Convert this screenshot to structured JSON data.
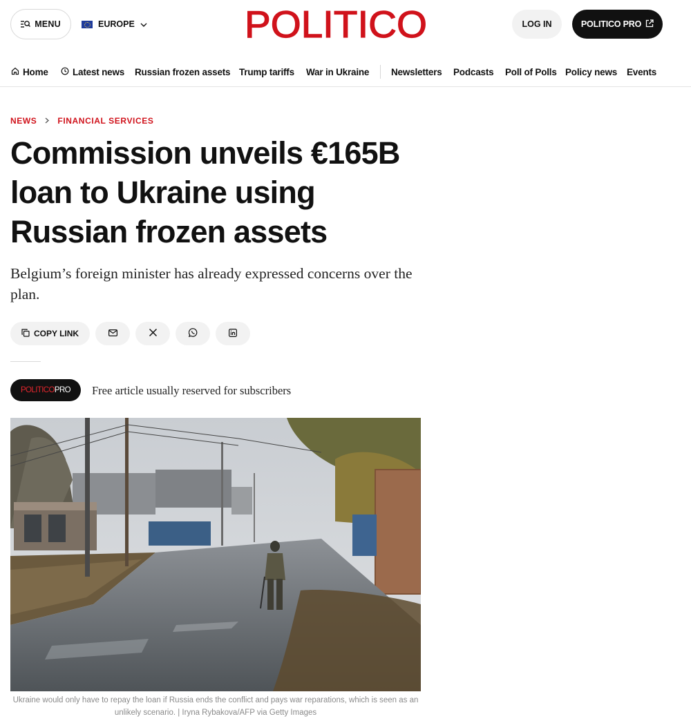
{
  "header": {
    "menu_label": "MENU",
    "edition_label": "EUROPE",
    "logo_text": "POLITICO",
    "login_label": "LOG IN",
    "pro_label": "POLITICO PRO"
  },
  "nav": {
    "items": [
      {
        "label": "Home",
        "icon": "home-icon"
      },
      {
        "label": "Latest news",
        "icon": "clock-icon"
      },
      {
        "label": "Russian frozen assets"
      },
      {
        "label": "Trump tariffs"
      },
      {
        "label": "War in Ukraine"
      },
      {
        "label": "Newsletters"
      },
      {
        "label": "Podcasts"
      },
      {
        "label": "Poll of Polls"
      },
      {
        "label": "Policy news"
      },
      {
        "label": "Events"
      }
    ]
  },
  "article": {
    "breadcrumb": [
      "NEWS",
      "FINANCIAL SERVICES"
    ],
    "headline": "Commission unveils €165B loan to Ukraine using Russian frozen assets",
    "dek": "Belgium’s foreign minister has already expressed concerns over the plan.",
    "share": {
      "copy_link_label": "COPY LINK",
      "icons": [
        "copy-link-icon",
        "email-icon",
        "x-icon",
        "whatsapp-icon",
        "linkedin-icon"
      ]
    },
    "pro_badge": {
      "part1": "POLITICO",
      "part2": "PRO"
    },
    "pro_note": "Free article usually reserved for subscribers",
    "image_caption": "Ukraine would only have to repay the loan if Russia ends the conflict and pays war reparations, which is seen as an unlikely scenario. | Iryna Rybakova/AFP via Getty Images"
  },
  "colors": {
    "brand_red": "#d0121b",
    "dark": "#111111",
    "pill_bg": "#f2f2f2"
  }
}
